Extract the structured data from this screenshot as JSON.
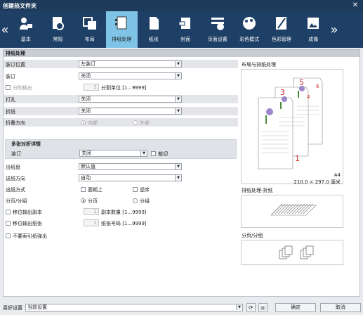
{
  "window": {
    "title": "创建热文件夹",
    "close_glyph": "✕"
  },
  "tabs": [
    {
      "label": "基本",
      "icon": "user-lock-icon"
    },
    {
      "label": "常规",
      "icon": "gear-document-icon"
    },
    {
      "label": "布局",
      "icon": "layout-icon"
    },
    {
      "label": "排纸处理",
      "icon": "finishing-icon",
      "active": true
    },
    {
      "label": "纸张",
      "icon": "paper-icon"
    },
    {
      "label": "封面",
      "icon": "cover-icon"
    },
    {
      "label": "页面设置",
      "icon": "page-setup-icon"
    },
    {
      "label": "彩色模式",
      "icon": "palette-icon"
    },
    {
      "label": "色彩管理",
      "icon": "color-management-icon"
    },
    {
      "label": "成像",
      "icon": "imaging-icon"
    }
  ],
  "section_title": "排纸处理",
  "form": {
    "binding_position": {
      "label": "装订位置",
      "value": "左装订"
    },
    "staple": {
      "label": "装订",
      "value": "关闭"
    },
    "offset": {
      "label": "分别输出",
      "spin": "1",
      "unit": "分割单位 [1...9999]"
    },
    "punch": {
      "label": "打孔",
      "value": "关闭"
    },
    "fold": {
      "label": "折纸",
      "value": "关闭"
    },
    "fold_direction": {
      "label": "折叠方向",
      "opt1": "内部",
      "opt2": "外部"
    },
    "multi_fold": {
      "title": "多张对折详情",
      "label": "装订",
      "value": "关闭",
      "trim": "裁切"
    },
    "output_tray": {
      "label": "出纸盘",
      "value": "默认值"
    },
    "feed_direction": {
      "label": "送纸方向",
      "value": "自动"
    },
    "output_method": {
      "label": "出纸方式",
      "opt1": "面朝上",
      "opt2": "逆序"
    },
    "sort_group": {
      "label": "分页/分组",
      "opt1": "分页",
      "opt2": "分组"
    },
    "shift_copies": {
      "label": "移位输出副本",
      "spin": "1",
      "unit": "副本数量 [1...9999]"
    },
    "shift_sheets": {
      "label": "移位输出纸张",
      "spin": "1",
      "unit": "纸张号码 [1...9999]"
    },
    "no_tab_eject": {
      "label": "不要索引纸弹出"
    }
  },
  "right": {
    "layout_title": "布局与排纸处理",
    "paper_size": "A4",
    "paper_dims": "210.0 × 297.0 毫米",
    "fold_title": "排纸处理-折纸",
    "sort_title": "分页/分组",
    "page_numbers": [
      "5",
      "3",
      "1",
      "6",
      "4"
    ]
  },
  "footer": {
    "favorites_label": "喜好设置",
    "favorites_value": "当前设置",
    "ok": "确定",
    "cancel": "取消"
  }
}
